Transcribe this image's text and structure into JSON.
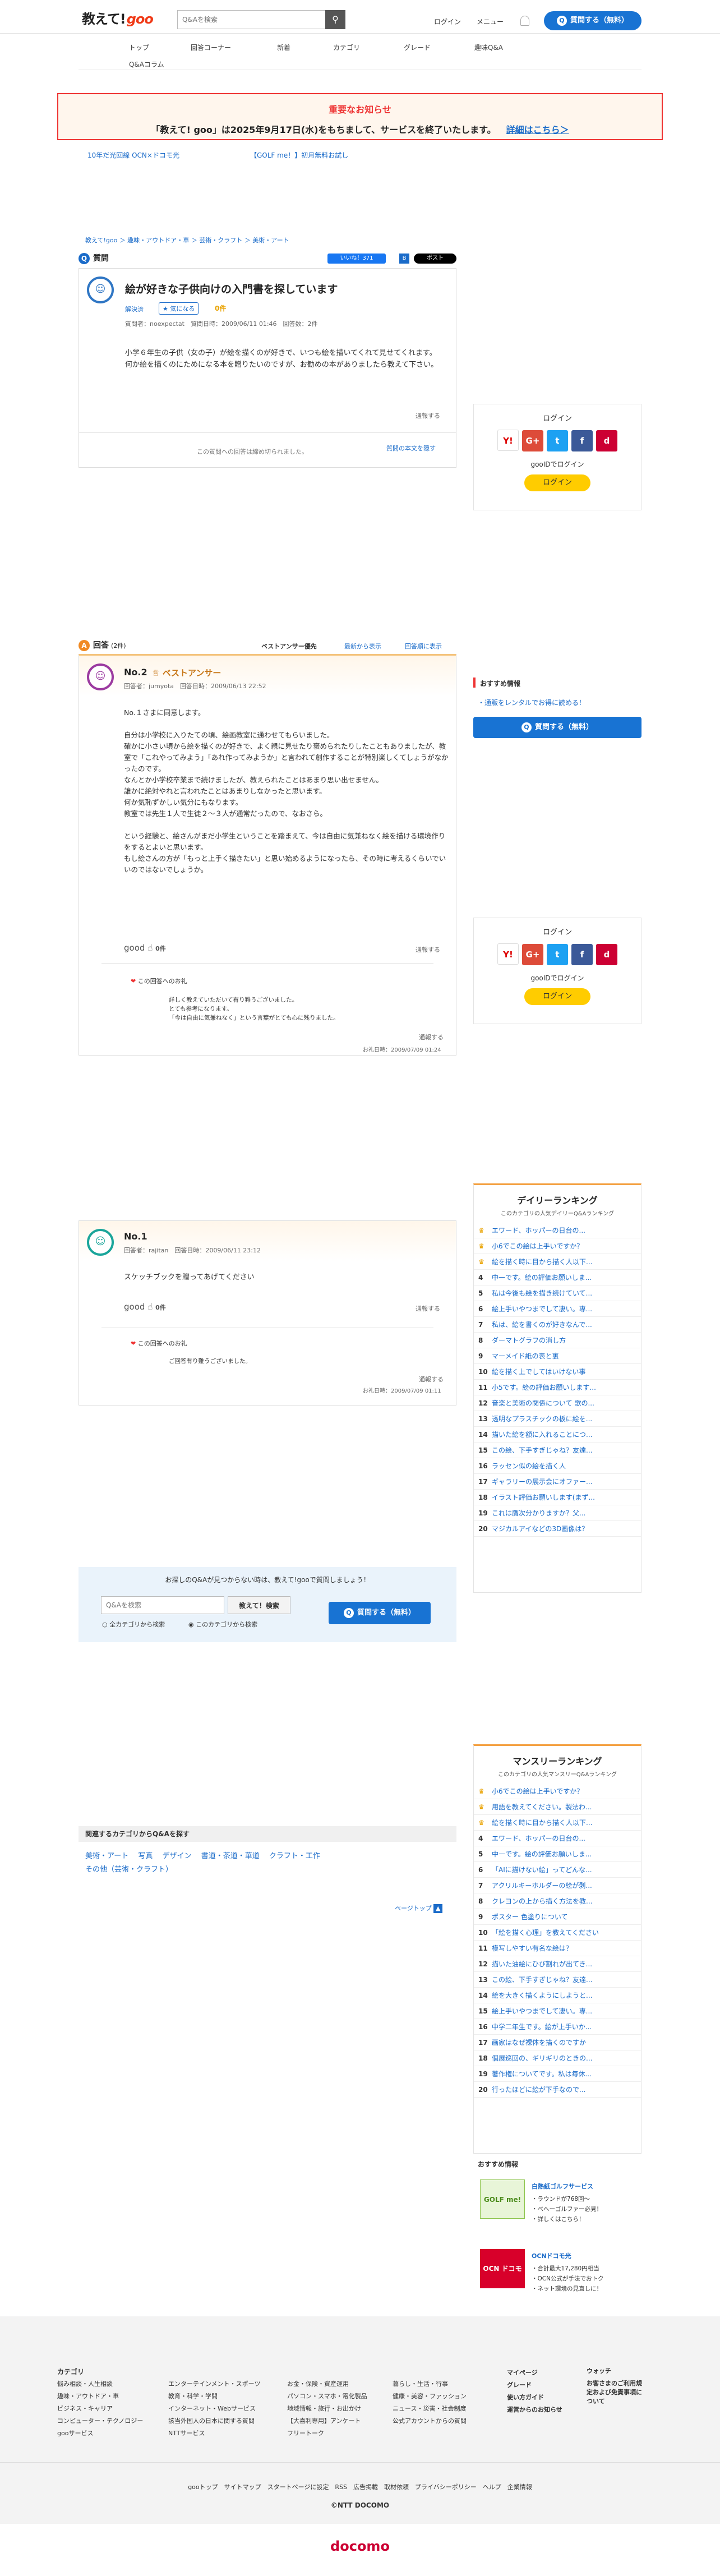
{
  "header": {
    "logo_text": "教えて!",
    "logo_goo": "goo",
    "search_placeholder": "Q&Aを検索",
    "search_icon": "search-icon",
    "login": "ログイン",
    "menu": "メニュー",
    "ask_button": "質問する（無料）"
  },
  "global_nav": [
    "トップ",
    "回答コーナー",
    "新着",
    "カテゴリ",
    "グレード",
    "趣味Q&A",
    "Q&Aコラム"
  ],
  "notice": {
    "title": "重要なお知らせ",
    "body": "「教えて! goo」は2025年9月17日(水)をもちまして、サービスを終了いたします。",
    "link": "詳細はこちら＞"
  },
  "ads": [
    "10年だ光回線 OCN×ドコモ光",
    "【GOLF me！】初月無料お試し"
  ],
  "breadcrumb": "教えて!goo ＞ 趣味・アウトドア・車 ＞ 芸術・クラフト ＞ 美術・アート",
  "question": {
    "section_label": "質問",
    "title": "絵が好きな子供向けの入門書を探しています",
    "status": "解決済",
    "favorite": "気になる",
    "favorite_count": "0件",
    "meta": "質問者：noexpectat　質問日時：2009/06/11 01:46　回答数：2件",
    "body": "小学６年生の子供（女の子）が絵を描くのが好きで、いつも絵を描いてくれて見せてくれます。\n何か絵を描くのにためになる本を贈りたいのですが、お勧めの本がありましたら教えて下さい。",
    "report": "通報する",
    "closed": "この質問への回答は締め切られました。",
    "full_text": "質問の本文を隠す",
    "share_like": "いいね！371",
    "share_tweet": "ポスト"
  },
  "answers": {
    "section_label": "回答",
    "count": "(2件)",
    "sort_best": "ベストアンサー優先",
    "sort_latest": "最新から表示",
    "sort_oldest": "回答順に表示",
    "items": [
      {
        "no": "No.2",
        "badge": "ベストアンサー",
        "meta": "回答者：jumyota　回答日時：2009/06/13 22:52",
        "body": "No.１さまに同意します。\n\n自分は小学校に入りたての頃、絵画教室に通わせてもらいました。\n確かに小さい頃から絵を描くのが好きで、よく親に見せたり褒められたりしたこともありましたが、教室で「これやってみよう」「あれ作ってみようか」と言われて創作することが特別楽しくてしょうがなかったのです。\nなんとか小学校卒業まで続けましたが、教えられたことはあまり思い出せません。\n誰かに絶対やれと言われたことはあまりしなかったと思います。\n何か気恥ずかしい気分にもなります。\n教室では先生１人で生徒２〜３人が通常だったので、なおさら。\n\nという経験と、絵さんがまだ小学生ということを踏まえて、今は自由に気兼ねなく絵を描ける環境作りをするとよいと思います。\nもし絵さんの方が「もっと上手く描きたい」と思い始めるようになったら、その時に考えるくらいでいいのではないでしょうか。",
        "good": "good",
        "good_count": "0件",
        "report": "通報する",
        "thanks_label": "この回答へのお礼",
        "thanks_body": "詳しく教えていただいて有り難うございました。\nとても参考になります。\n「今は自由に気兼ねなく」という言葉がとても心に残りました。",
        "thanks_date": "お礼日時：2009/07/09 01:24"
      },
      {
        "no": "No.1",
        "badge": "",
        "meta": "回答者：rajitan　回答日時：2009/06/11 23:12",
        "body": "スケッチブックを贈ってあげてください",
        "good": "good",
        "good_count": "0件",
        "report": "通報する",
        "thanks_label": "この回答へのお礼",
        "thanks_body": "ご回答有り難うございました。",
        "thanks_date": "お礼日時：2009/07/09 01:11"
      }
    ]
  },
  "ask_prompt": {
    "text": "お探しのQ&Aが見つからない時は、教えて!gooで質問しましょう！",
    "search_placeholder": "Q&Aを検索",
    "search_button": "教えて！検索",
    "radio_all": "全カテゴリから検索",
    "radio_this": "このカテゴリから検索",
    "ask_button": "質問する（無料）"
  },
  "related": {
    "heading": "関連するカテゴリからQ&Aを探す",
    "links": [
      "美術・アート",
      "写真",
      "デザイン",
      "書道・茶道・華道",
      "クラフト・工作",
      "その他（芸術・クラフト）"
    ]
  },
  "pagetop": "ページトップ",
  "sidebar": {
    "login_title": "ログイン",
    "goo_id": "gooIDでログイン",
    "login_button": "ログイン",
    "sns": [
      "Y!",
      "G+",
      "t",
      "f",
      "d"
    ],
    "recommend_title": "おすすめ情報",
    "recommend_link": "・通販をレンタルでお得に読める！",
    "ask_button": "質問する（無料）"
  },
  "daily_ranking": {
    "title": "デイリーランキング",
    "subtitle": "このカテゴリの人気デイリーQ&Aランキング",
    "items": [
      "エワード、ホッパーの日台の...",
      "小6でこの絵は上手いですか？",
      "絵を描く時に目から描く人以下...",
      "中一です。絵の評価お願いしま...",
      "私は今後も絵を描き続けていて...",
      "絵上手いやつまでして凄い。専...",
      "私は、絵を書くのが好きなんで...",
      "ダーマトグラフの消し方",
      "マーメイド紙の表と裏",
      "絵を描く上でしてはいけない事",
      "小5です。絵の評価お願いします...",
      "音楽と美術の関係について 歌の...",
      "透明なプラスチックの板に絵を...",
      "描いた絵を額に入れることにつ...",
      "この絵、下手すぎじゃね？友達...",
      "ラッセン似の絵を描く人",
      "ギャラリーの展示会にオファー...",
      "イラスト評価お願いします(まず...",
      "これは贋次分かりますか？父...",
      "マジカルアイなどの3D画像は？"
    ]
  },
  "monthly_ranking": {
    "title": "マンスリーランキング",
    "subtitle": "このカテゴリの人気マンスリーQ&Aランキング",
    "items": [
      "小6でこの絵は上手いですか？",
      "用語を教えてください。製法わ...",
      "絵を描く時に目から描く人以下...",
      "エワード、ホッパーの日台の...",
      "中一です。絵の評価お願いしま...",
      "「AIに描けない絵」ってどんな...",
      "アクリルキーホルダーの絵が剥...",
      "クレヨンの上から描く方法を教...",
      "ポスター 色塗りについて",
      "「絵を描く心理」を教えてください",
      "模写しやすい有名な絵は？",
      "描いた油絵にひび割れが出てき...",
      "この絵、下手すぎじゃね？友達...",
      "絵を大きく描くようにしようと...",
      "絵上手いやつまでして凄い。専...",
      "中学二年生です。絵が上手いか...",
      "画家はなぜ裸体を描くのですか",
      "個展巡回の、ギリギリのときの...",
      "著作権についてです。私は毎休...",
      "行ったほどに絵が下手なので..."
    ]
  },
  "osusume": {
    "title": "おすすめ情報",
    "items": [
      {
        "head": "白熱紙ゴルフサービス",
        "lines": [
          "・ラウンドが768回〜",
          "・ベヘーゴルファー必見！",
          "・詳しくはこちら！"
        ],
        "img": "GOLF me!"
      },
      {
        "head": "OCNドコモ光",
        "lines": [
          "・合計最大17,280円相当",
          "・OCN公式が手法でおトク",
          "・ネット環境の見直しに！"
        ],
        "img": "OCN ドコモ光"
      }
    ]
  },
  "footer": {
    "category_title": "カテゴリ",
    "cols": [
      [
        "悩み相談・人生相談",
        "趣味・アウトドア・車",
        "ビジネス・キャリア",
        "コンピューター・テクノロジー",
        "gooサービス"
      ],
      [
        "エンターテインメント・スポーツ",
        "教育・科学・学問",
        "インターネット・Webサービス",
        "該当外国人の日本に関する質問",
        "NTTサービス"
      ],
      [
        "お金・保険・資産運用",
        "パソコン・スマホ・電化製品",
        "地域情報・旅行・お出かけ",
        "【大喜利専用】アンケート",
        "フリートーク"
      ],
      [
        "暮らし・生活・行事",
        "健康・美容・ファッション",
        "ニュース・災害・社会制度",
        "公式アカウントからの質問"
      ]
    ],
    "right1": [
      "マイページ",
      "グレード",
      "使い方ガイド",
      "運営からのお知らせ"
    ],
    "right2": [
      "ウォッチ",
      "お客さまのご利用規定および免責事項について"
    ],
    "bottom_links": "gooトップ　サイトマップ　スタートページに設定　RSS　広告掲載　取材依頼　プライバシーポリシー　ヘルプ　企業情報",
    "copyright": "©NTT DOCOMO",
    "docomo": "docomo"
  }
}
